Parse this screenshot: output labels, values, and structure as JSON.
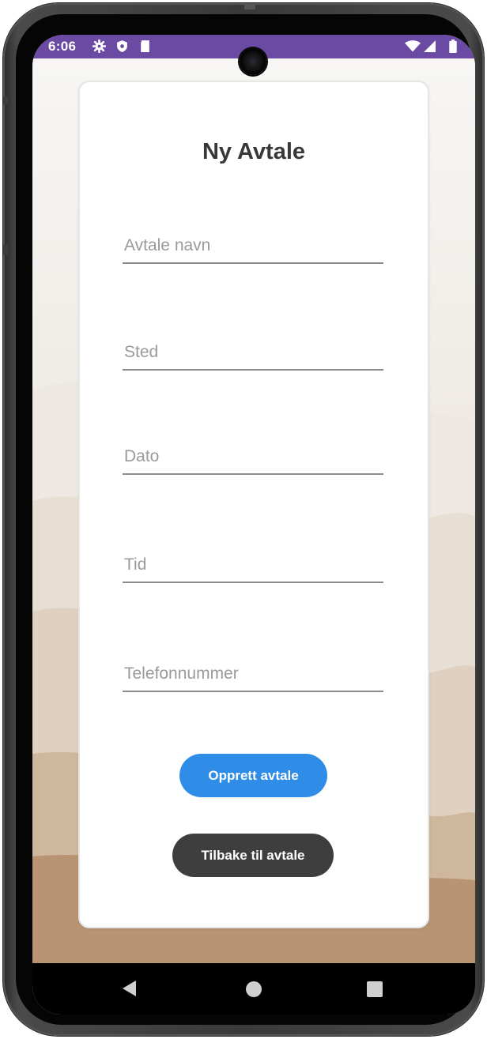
{
  "status_bar": {
    "time": "6:06",
    "left_icons": [
      "gear-icon",
      "shield-icon",
      "sd-card-icon"
    ],
    "right_icons": [
      "wifi-icon",
      "signal-icon",
      "battery-icon"
    ]
  },
  "form": {
    "title": "Ny Avtale",
    "fields": [
      {
        "name": "appointment-name",
        "placeholder": "Avtale navn",
        "value": ""
      },
      {
        "name": "location",
        "placeholder": "Sted",
        "value": ""
      },
      {
        "name": "date",
        "placeholder": "Dato",
        "value": ""
      },
      {
        "name": "time",
        "placeholder": "Tid",
        "value": ""
      },
      {
        "name": "phone-number",
        "placeholder": "Telefonnummer",
        "value": ""
      }
    ],
    "create_button_label": "Opprett avtale",
    "back_button_label": "Tilbake til avtale"
  },
  "nav_bar": {
    "items": [
      "back-icon",
      "home-icon",
      "recents-icon"
    ]
  },
  "colors": {
    "status_bar": "#6a4aa3",
    "primary_button": "#2f8de8",
    "secondary_button": "#3e3e3e"
  }
}
